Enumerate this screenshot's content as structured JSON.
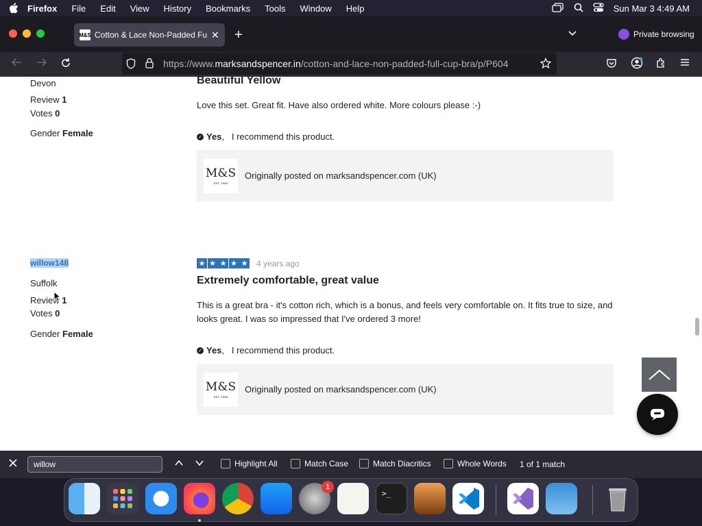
{
  "menubar": {
    "app": "Firefox",
    "items": [
      "File",
      "Edit",
      "View",
      "History",
      "Bookmarks",
      "Tools",
      "Window",
      "Help"
    ],
    "datetime": "Sun Mar 3  4:49 AM"
  },
  "tab": {
    "title": "Cotton & Lace Non-Padded Full",
    "favicon_text": "M&S"
  },
  "private_label": "Private browsing",
  "url": {
    "prefix": "https://www.",
    "domain": "marksandspencer.in",
    "path": "/cotton-and-lace-non-padded-full-cup-bra/p/P604"
  },
  "reviews": [
    {
      "username": "",
      "location": "Devon",
      "review_label": "Review",
      "review_count": "1",
      "votes_label": "Votes",
      "votes_count": "0",
      "gender_label": "Gender",
      "gender": "Female",
      "title": "Beautiful Yellow",
      "text": "Love this set. Great fit. Have also ordered white. More colours please :-)",
      "recommend_yes": "Yes",
      "recommend_text": "I recommend this product.",
      "posted_text": "Originally posted on marksandspencer.com (UK)"
    },
    {
      "username": "willow148",
      "rating": 5,
      "ago": "4 years ago",
      "location": "Suffolk",
      "review_label": "Review",
      "review_count": "1",
      "votes_label": "Votes",
      "votes_count": "0",
      "gender_label": "Gender",
      "gender": "Female",
      "title": "Extremely comfortable, great value",
      "text": "This is a great bra - it's cotton rich, which is a bonus, and feels very comfortable on. It fits true to size, and looks great. I was so impressed that I've ordered 3 more!",
      "recommend_yes": "Yes",
      "recommend_text": "I recommend this product.",
      "posted_text": "Originally posted on marksandspencer.com (UK)"
    }
  ],
  "logo": {
    "text": "M&S",
    "sub": "EST. 1884"
  },
  "findbar": {
    "query": "willow",
    "highlight_all": "Highlight All",
    "match_case": "Match Case",
    "match_diacritics": "Match Diacritics",
    "whole_words": "Whole Words",
    "matches": "1 of 1 match"
  },
  "dock": {
    "badge": "1",
    "apps": [
      "finder-icon",
      "launchpad-icon",
      "safari-icon",
      "firefox-icon",
      "chrome-icon",
      "app-store-icon",
      "system-settings-icon",
      "textedit-icon",
      "terminal-icon",
      "garageband-icon",
      "vscode-icon",
      "visual-studio-icon",
      "weather-icon",
      "trash-icon"
    ]
  },
  "colors": {
    "star": "#2b74b5",
    "highlight": "#b5d3f7",
    "private": "#8b4fdc"
  }
}
